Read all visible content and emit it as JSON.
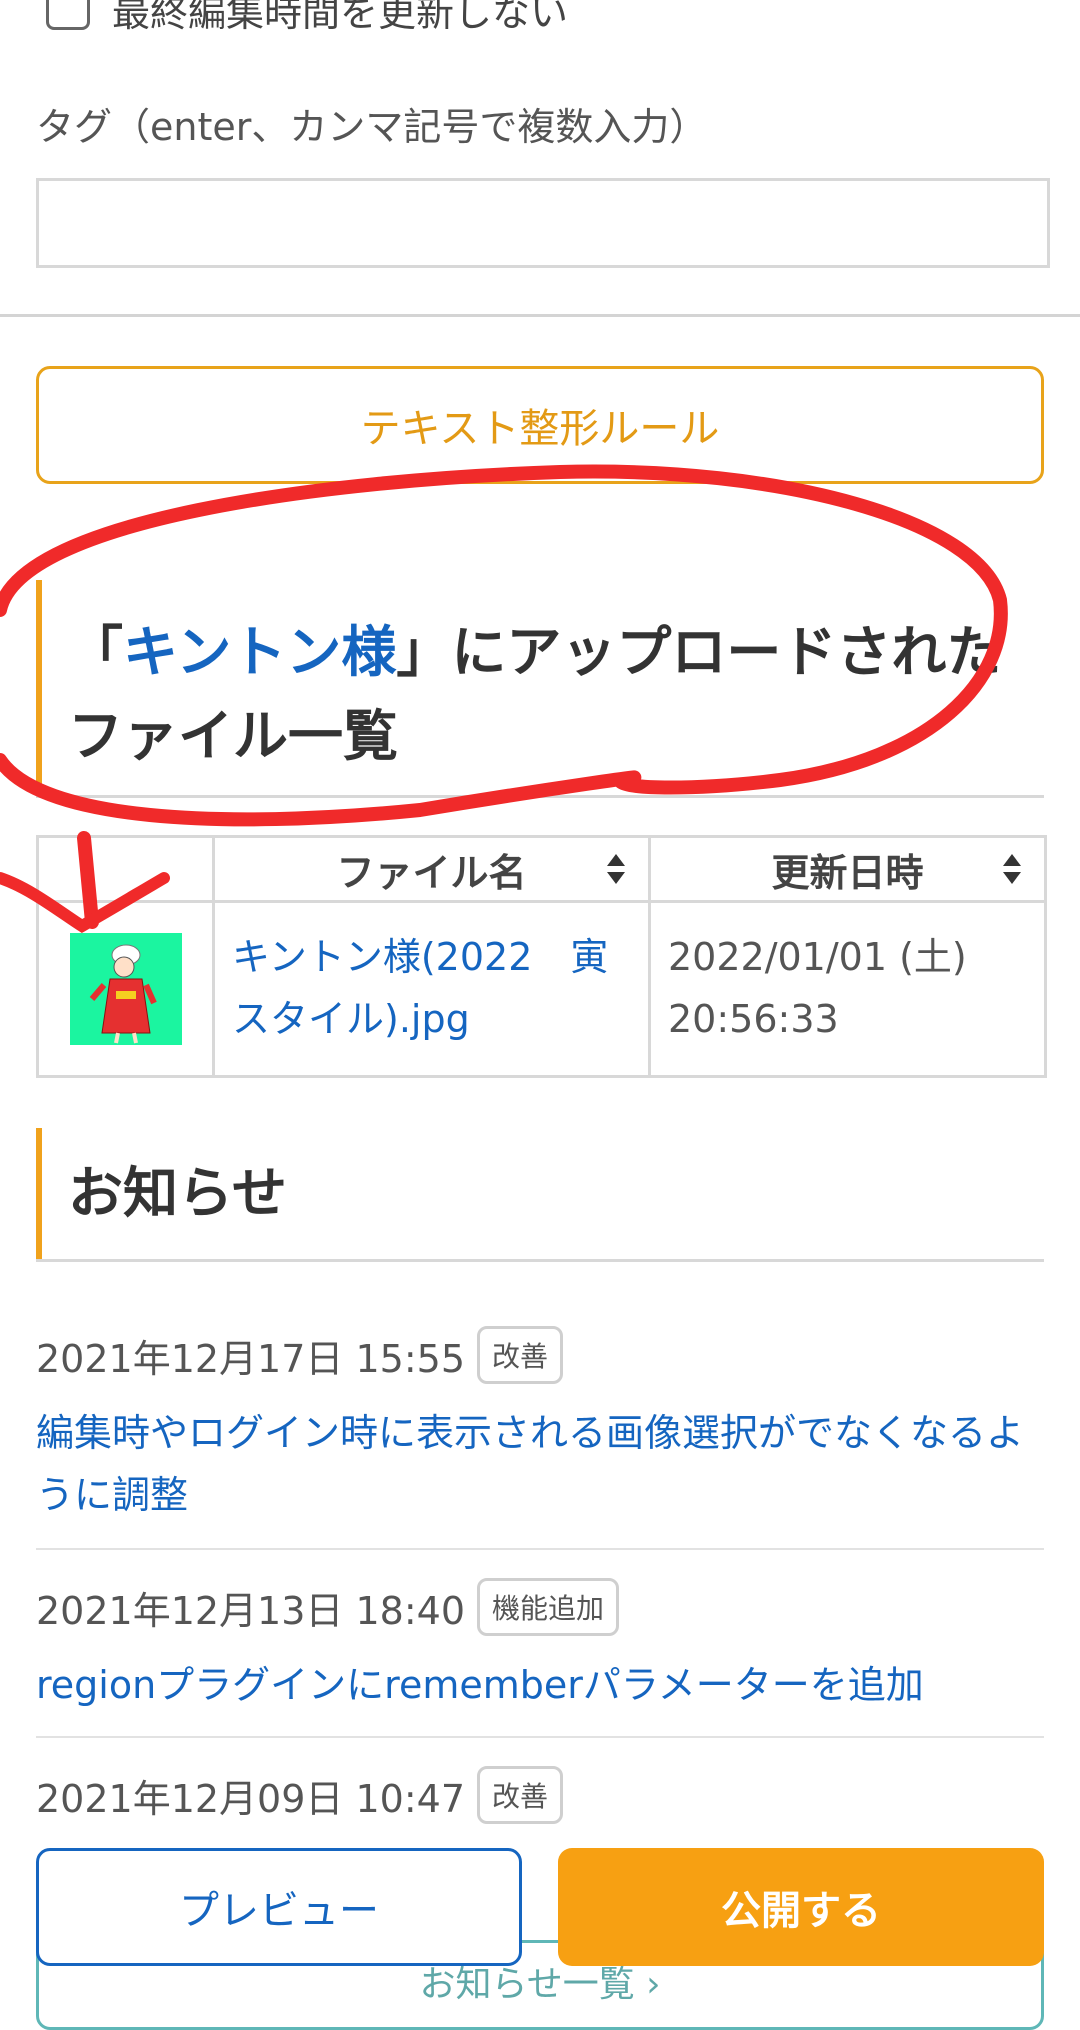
{
  "form": {
    "no_update_time_label": "最終編集時間を更新しない",
    "tag_label": "タグ（enter、カンマ記号で複数入力）",
    "tag_value": "",
    "rules_button": "テキスト整形ルール"
  },
  "uploads": {
    "title_open": "「",
    "title_name": "キントン様",
    "title_rest": "」にアップロードされたファイル一覧",
    "col_file": "ファイル名",
    "col_date": "更新日時",
    "rows": [
      {
        "name": "キントン様(2022　寅スタイル).jpg",
        "date": "2022/01/01 (土) 20:56:33"
      }
    ]
  },
  "news": {
    "title": "お知らせ",
    "items": [
      {
        "date": "2021年12月17日 15:55",
        "badge": "改善",
        "title": "編集時やログイン時に表示される画像選択がでなくなるように調整"
      },
      {
        "date": "2021年12月13日 18:40",
        "badge": "機能追加",
        "title": "regionプラグインにrememberパラメーターを追加"
      },
      {
        "date": "2021年12月09日 10:47",
        "badge": "改善",
        "title": ""
      }
    ],
    "more_link": "お知らせ一覧 ›"
  },
  "actions": {
    "preview": "プレビュー",
    "publish": "公開する"
  },
  "colors": {
    "accent_orange": "#f7a012",
    "link_blue": "#1565c0",
    "annotation_red": "#f02a2a"
  }
}
